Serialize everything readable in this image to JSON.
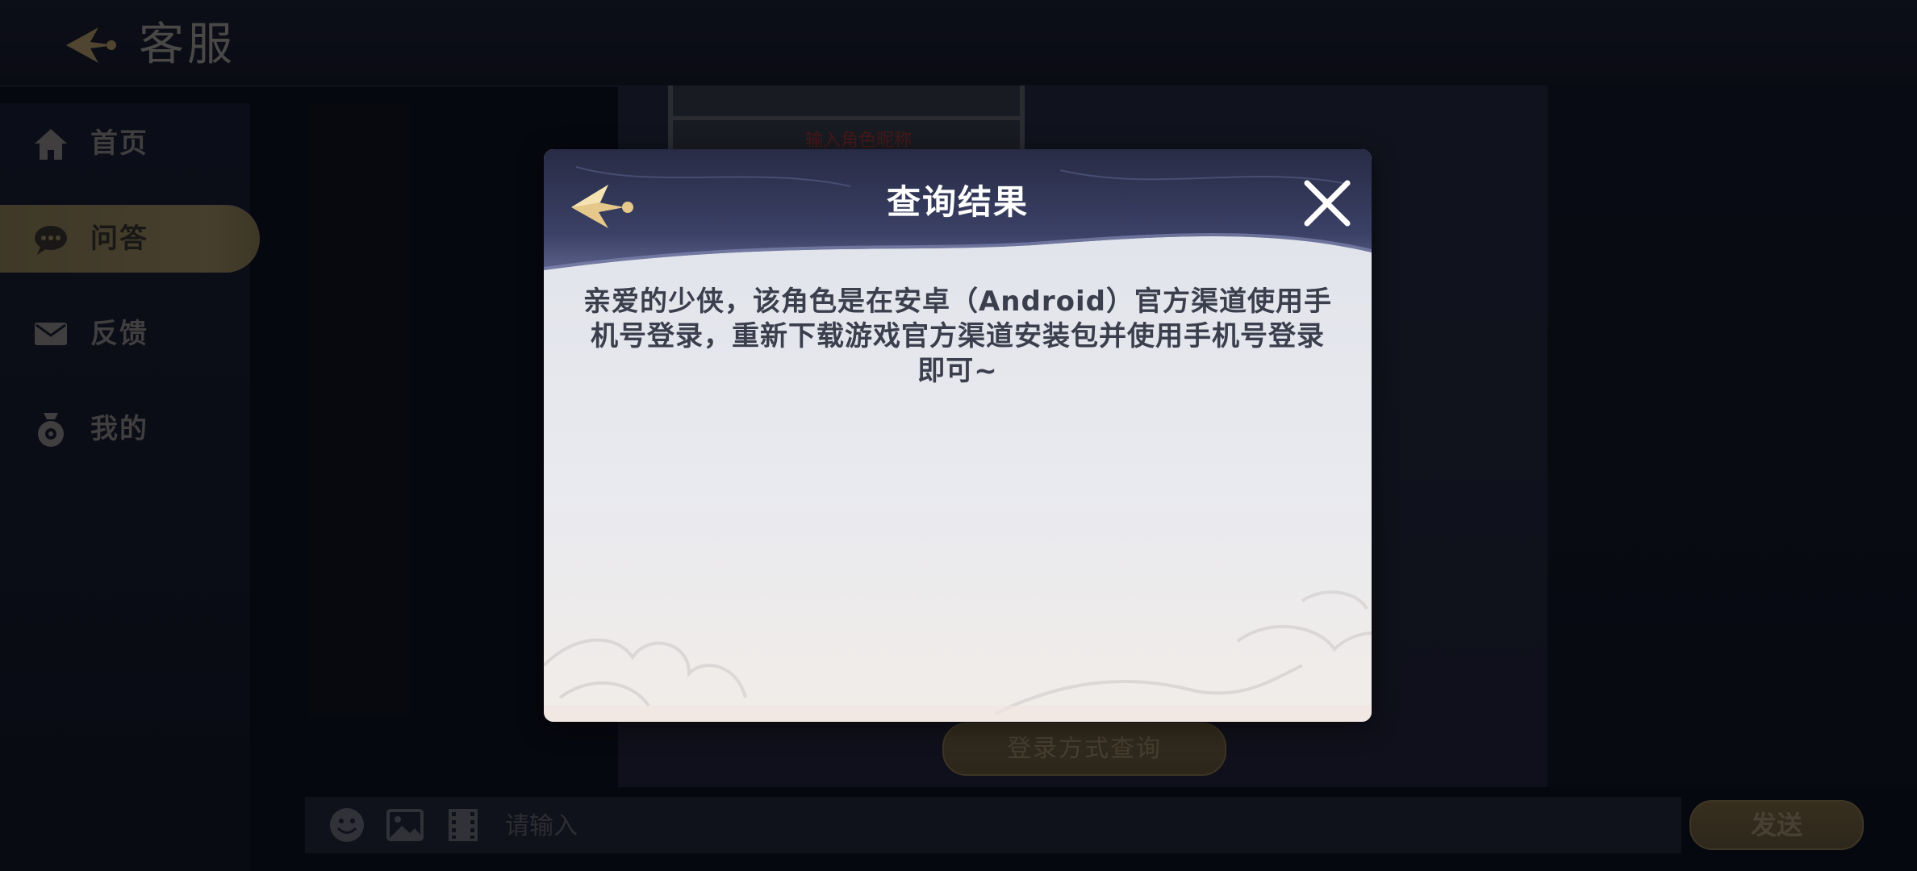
{
  "header": {
    "title": "客服"
  },
  "sidebar": {
    "items": [
      {
        "label": "首页",
        "icon": "home-icon"
      },
      {
        "label": "问答",
        "icon": "chat-bubble-icon",
        "active": true
      },
      {
        "label": "反馈",
        "icon": "mail-icon"
      },
      {
        "label": "我的",
        "icon": "profile-icon"
      }
    ]
  },
  "main": {
    "reference_annotation": "输入角色昵称",
    "query_button_label": "登录方式查询"
  },
  "input_bar": {
    "placeholder": "请输入",
    "value": "",
    "tools": [
      "emoji-icon",
      "image-icon",
      "video-icon"
    ],
    "send_label": "发送"
  },
  "modal": {
    "title": "查询结果",
    "message_lines": [
      "亲爱的少侠，该角色是在安卓（Android）官方渠道使用手",
      "机号登录，重新下载游戏官方渠道安装包并使用手机号登录",
      "即可~"
    ]
  },
  "colors": {
    "background": "#0c0f1a",
    "accent_gold": "#c9a96a",
    "modal_header": "#2f3556",
    "modal_body_text": "#3b3f4d"
  }
}
